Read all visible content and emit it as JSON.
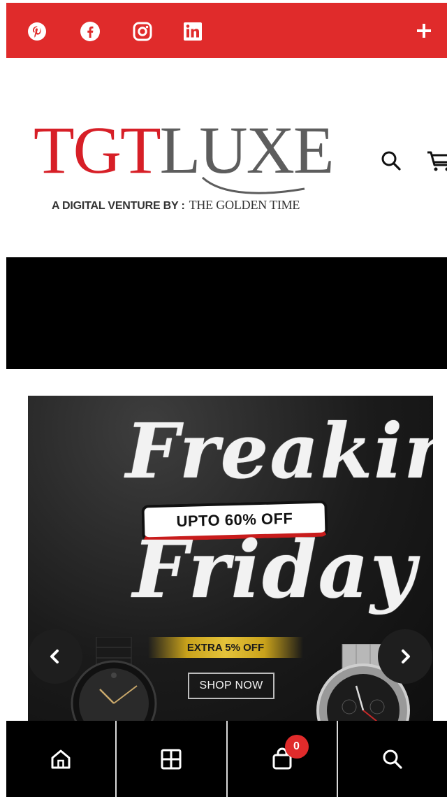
{
  "topbar": {
    "color": "#e02b2b",
    "social_icons": [
      "pinterest-icon",
      "facebook-icon",
      "instagram-icon",
      "linkedin-icon"
    ],
    "plus_icon": "plus-icon"
  },
  "header": {
    "logo_part1": "TGT",
    "logo_part2": "LUXE",
    "tagline_prefix": "A DIGITAL VENTURE BY :",
    "tagline_brand": "THE GOLDEN TIME",
    "logo_colors": {
      "tgt": "#d71f27",
      "luxe": "#5d5d5d"
    },
    "icons": [
      "search-icon",
      "cart-icon"
    ]
  },
  "banner": {
    "headline_word1": "Freakin",
    "headline_word2": "Friday",
    "offer": "UPTO 60% OFF",
    "extra": "EXTRA 5% OFF",
    "cta": "SHOP NOW",
    "prev_icon": "chevron-left-icon",
    "next_icon": "chevron-right-icon"
  },
  "bottom_nav": {
    "items": [
      {
        "icon": "home-icon"
      },
      {
        "icon": "grid-icon"
      },
      {
        "icon": "bag-icon",
        "badge": "0"
      },
      {
        "icon": "search-icon"
      }
    ],
    "badge_color": "#e02b2b"
  }
}
